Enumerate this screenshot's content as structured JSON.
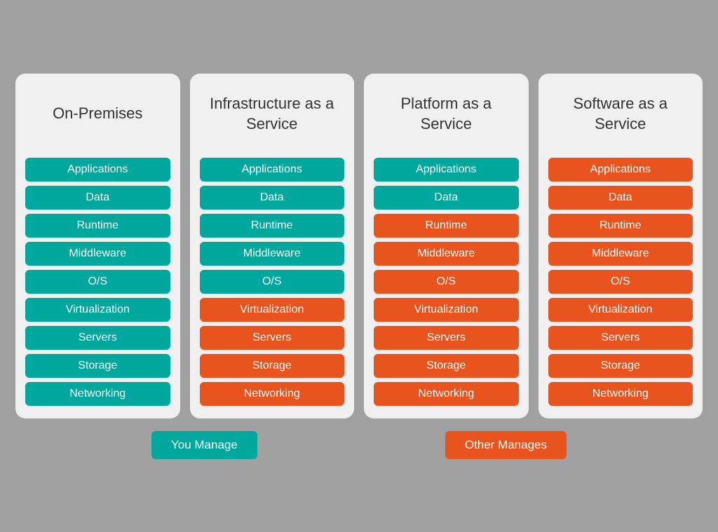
{
  "columns": [
    {
      "id": "on-premises",
      "title": "On-Premises",
      "items": [
        {
          "label": "Applications",
          "color": "teal"
        },
        {
          "label": "Data",
          "color": "teal"
        },
        {
          "label": "Runtime",
          "color": "teal"
        },
        {
          "label": "Middleware",
          "color": "teal"
        },
        {
          "label": "O/S",
          "color": "teal"
        },
        {
          "label": "Virtualization",
          "color": "teal"
        },
        {
          "label": "Servers",
          "color": "teal"
        },
        {
          "label": "Storage",
          "color": "teal"
        },
        {
          "label": "Networking",
          "color": "teal"
        }
      ]
    },
    {
      "id": "iaas",
      "title": "Infrastructure\nas a Service",
      "items": [
        {
          "label": "Applications",
          "color": "teal"
        },
        {
          "label": "Data",
          "color": "teal"
        },
        {
          "label": "Runtime",
          "color": "teal"
        },
        {
          "label": "Middleware",
          "color": "teal"
        },
        {
          "label": "O/S",
          "color": "teal"
        },
        {
          "label": "Virtualization",
          "color": "orange"
        },
        {
          "label": "Servers",
          "color": "orange"
        },
        {
          "label": "Storage",
          "color": "orange"
        },
        {
          "label": "Networking",
          "color": "orange"
        }
      ]
    },
    {
      "id": "paas",
      "title": "Platform\nas a Service",
      "items": [
        {
          "label": "Applications",
          "color": "teal"
        },
        {
          "label": "Data",
          "color": "teal"
        },
        {
          "label": "Runtime",
          "color": "orange"
        },
        {
          "label": "Middleware",
          "color": "orange"
        },
        {
          "label": "O/S",
          "color": "orange"
        },
        {
          "label": "Virtualization",
          "color": "orange"
        },
        {
          "label": "Servers",
          "color": "orange"
        },
        {
          "label": "Storage",
          "color": "orange"
        },
        {
          "label": "Networking",
          "color": "orange"
        }
      ]
    },
    {
      "id": "saas",
      "title": "Software\nas a Service",
      "items": [
        {
          "label": "Applications",
          "color": "orange"
        },
        {
          "label": "Data",
          "color": "orange"
        },
        {
          "label": "Runtime",
          "color": "orange"
        },
        {
          "label": "Middleware",
          "color": "orange"
        },
        {
          "label": "O/S",
          "color": "orange"
        },
        {
          "label": "Virtualization",
          "color": "orange"
        },
        {
          "label": "Servers",
          "color": "orange"
        },
        {
          "label": "Storage",
          "color": "orange"
        },
        {
          "label": "Networking",
          "color": "orange"
        }
      ]
    }
  ],
  "legend": {
    "you_manage": "You Manage",
    "other_manages": "Other Manages"
  }
}
